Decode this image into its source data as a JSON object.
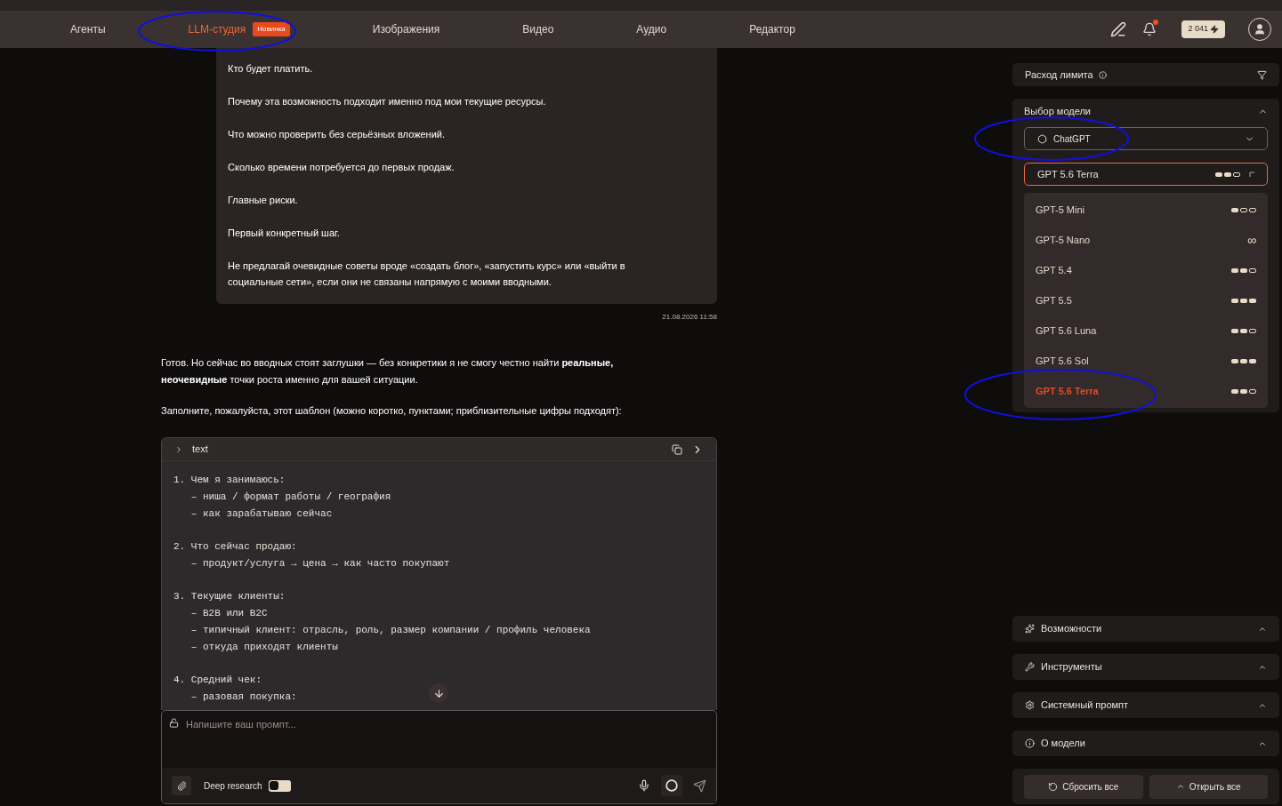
{
  "nav": {
    "items": [
      {
        "label": "Агенты",
        "selected": false
      },
      {
        "label": "LLM-студия",
        "selected": true,
        "badge": "Новинка"
      },
      {
        "label": "Изображения",
        "selected": false
      },
      {
        "label": "Видео",
        "selected": false
      },
      {
        "label": "Аудио",
        "selected": false
      },
      {
        "label": "Редактор",
        "selected": false
      }
    ],
    "balance": "2 041",
    "notification": true
  },
  "user_message": {
    "paragraphs": [
      "Кто будет платить.",
      "Почему эта возможность подходит именно под мои текущие ресурсы.",
      "Что можно проверить без серьёзных вложений.",
      "Сколько времени потребуется до первых продаж.",
      "Главные риски.",
      "Первый конкретный шаг.",
      "Не предлагай очевидные советы вроде «создать блог», «запустить курс» или «выйти в социальные сети», если они не связаны напрямую с моими вводными."
    ],
    "timestamp": "21.08.2026 11:58"
  },
  "assistant_message": {
    "paragraphs": [
      "Готов. Но сейчас во вводных стоят заглушки — без конкретики я не смогу честно найти **реальные, неочевидные** точки роста именно для вашей ситуации.",
      "Заполните, пожалуйста, этот шаблон (можно коротко, пунктами; приблизительные цифры подходят):"
    ],
    "code_block": {
      "language": "text",
      "groups": [
        [
          "1. Чем я занимаюсь:",
          "   – ниша / формат работы / география",
          "   – как зарабатываю сейчас"
        ],
        [
          "2. Что сейчас продаю:",
          "   – продукт/услуга → цена → как часто покупают"
        ],
        [
          "3. Текущие клиенты:",
          "   – B2B или B2C",
          "   – типичный клиент: отрасль, роль, размер компании / профиль человека",
          "   – откуда приходят клиенты"
        ],
        [
          "4. Средний чек:",
          "   – разовая покупка:"
        ]
      ]
    }
  },
  "composer": {
    "placeholder": "Напишите ваш промпт...",
    "deep_research": {
      "label": "Deep research",
      "on": false
    }
  },
  "sidebar": {
    "limit_title": "Расход лимита",
    "model_section": {
      "title": "Выбор модели",
      "expanded": true,
      "provider": "ChatGPT",
      "current": {
        "name": "GPT 5.6 Terra",
        "stars": 2
      },
      "models": [
        {
          "name": "GPT-5 Mini",
          "kind": "dots",
          "stars": 1,
          "selected": false
        },
        {
          "name": "GPT-5 Nano",
          "kind": "unlimited",
          "symbol": "∞",
          "selected": false
        },
        {
          "name": "GPT 5.4",
          "kind": "dots",
          "stars": 2,
          "selected": false
        },
        {
          "name": "GPT 5.5",
          "kind": "dots",
          "stars": 3,
          "selected": false
        },
        {
          "name": "GPT 5.6 Luna",
          "kind": "dots",
          "stars": 2,
          "selected": false
        },
        {
          "name": "GPT 5.6 Sol",
          "kind": "dots",
          "stars": 3,
          "selected": false
        },
        {
          "name": "GPT 5.6 Terra",
          "kind": "dots",
          "stars": 2,
          "selected": true
        }
      ]
    },
    "sections": [
      {
        "title": "Возможности",
        "kind": "sparkles",
        "expanded": false
      },
      {
        "title": "Инструменты",
        "kind": "tools",
        "expanded": false
      },
      {
        "title": "Системный промпт",
        "kind": "gear",
        "expanded": false
      },
      {
        "title": "О модели",
        "kind": "info",
        "expanded": false
      }
    ],
    "reset_button": "Сбросить все",
    "open_all_button": "Открыть все"
  }
}
